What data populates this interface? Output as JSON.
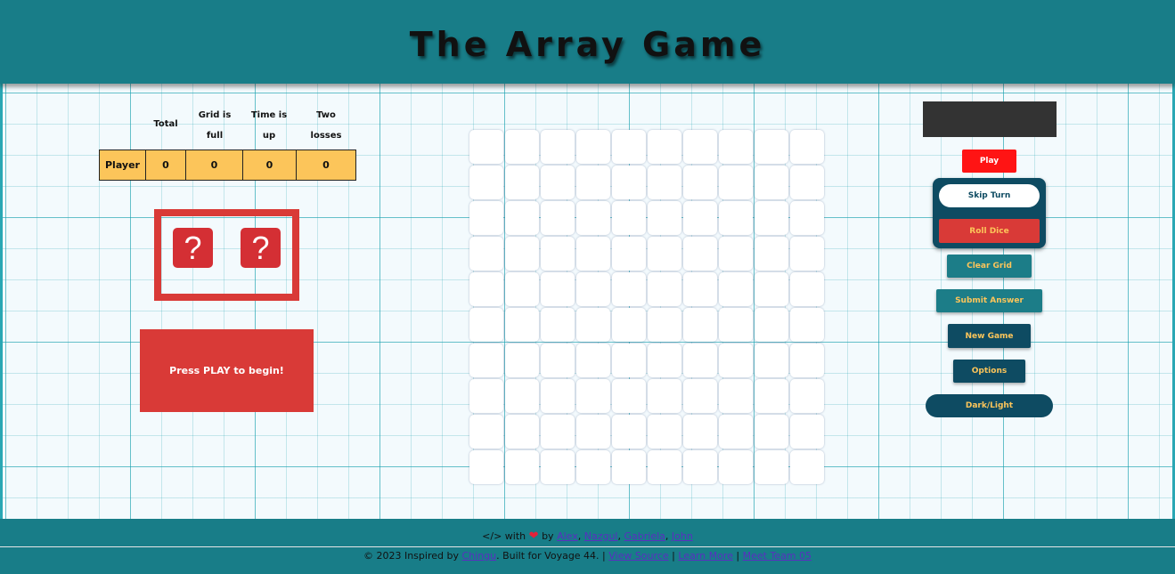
{
  "header": {
    "title": "The Array Game"
  },
  "scoreboard": {
    "headers": [
      "Total",
      "Grid is full",
      "Time is up",
      "Two losses"
    ],
    "row": {
      "player": "Player",
      "values": [
        "0",
        "0",
        "0",
        "0"
      ]
    }
  },
  "dice": {
    "die1": "?",
    "die2": "?"
  },
  "message": "Press PLAY to begin!",
  "controls": {
    "play": "Play",
    "skip_turn": "Skip Turn",
    "roll_dice": "Roll Dice",
    "clear_grid": "Clear Grid",
    "submit_answer": "Submit Answer",
    "new_game": "New Game",
    "options": "Options",
    "dark_light": "Dark/Light"
  },
  "grid": {
    "rows": 10,
    "cols": 10
  },
  "footer": {
    "made_with": "</> with",
    "by": "by",
    "authors": [
      "Alex",
      "Nazgul",
      "Gabriela",
      "John"
    ],
    "copyright": "© 2023 Inspired by",
    "chingu": "Chingu",
    "built_for": ". Built for Voyage 44. |",
    "view_source": "View Source",
    "learn_more": "Learn More",
    "meet_team": "Meet Team 05",
    "sep": "|"
  },
  "colors": {
    "header": "#187d88",
    "accent_red": "#d93a37",
    "score_yellow": "#fcc55a",
    "dark_teal": "#0e4b62"
  }
}
